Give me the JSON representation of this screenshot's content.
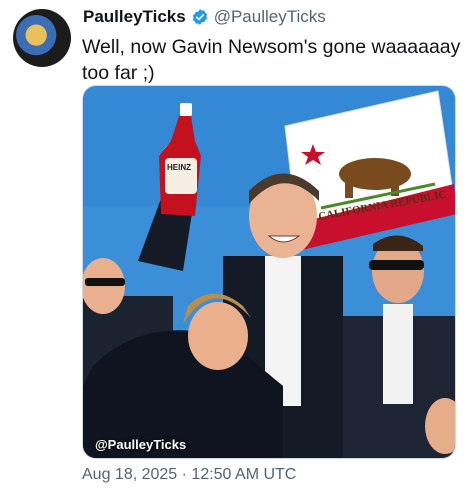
{
  "tweet": {
    "display_name": "PaulleyTicks",
    "handle": "@PaulleyTicks",
    "verified_icon": "verified-badge-icon",
    "text": "Well, now Gavin Newsom's gone waaaaaay too far ;)",
    "timestamp": "Aug 18, 2025 · 12:50 AM UTC"
  },
  "media": {
    "watermark": "@PaulleyTicks",
    "ketchup_label": "HEINZ",
    "flag_text": "CALIFORNIA REPUBLIC"
  },
  "colors": {
    "sky": "#3b8fd8",
    "verified": "#1d9bf0",
    "flag_red": "#c8102e",
    "handle_gray": "#536471"
  }
}
